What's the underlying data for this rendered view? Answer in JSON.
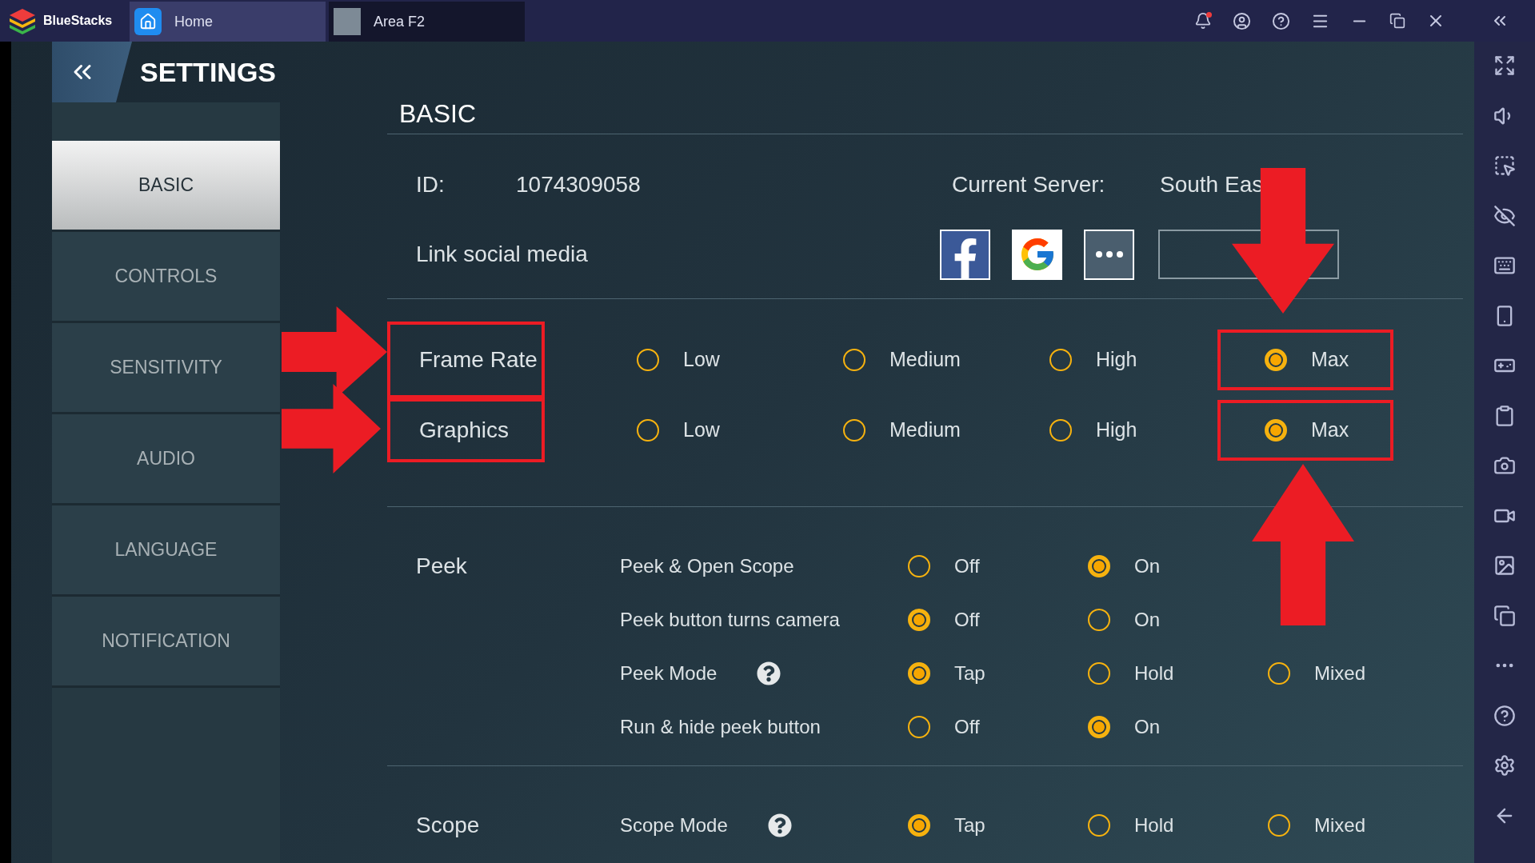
{
  "top_bar": {
    "app_name": "BlueStacks",
    "tabs": [
      {
        "label": "Home",
        "kind": "home",
        "selected": true
      },
      {
        "label": "Area F2",
        "kind": "game",
        "selected": false
      }
    ],
    "notification_dot": true
  },
  "settings": {
    "title": "SETTINGS",
    "menu": [
      {
        "label": "BASIC",
        "selected": true
      },
      {
        "label": "CONTROLS",
        "selected": false
      },
      {
        "label": "SENSITIVITY",
        "selected": false
      },
      {
        "label": "AUDIO",
        "selected": false
      },
      {
        "label": "LANGUAGE",
        "selected": false
      },
      {
        "label": "NOTIFICATION",
        "selected": false
      }
    ]
  },
  "basic": {
    "title": "BASIC",
    "id_label": "ID:",
    "id_value": "1074309058",
    "server_label": "Current Server:",
    "server_value": "South Eas",
    "link_label": "Link social media"
  },
  "quality": [
    {
      "label": "Frame Rate",
      "highlighted": true,
      "options": [
        {
          "label": "Low",
          "selected": false,
          "highlighted": false
        },
        {
          "label": "Medium",
          "selected": false,
          "highlighted": false
        },
        {
          "label": "High",
          "selected": false,
          "highlighted": false
        },
        {
          "label": "Max",
          "selected": true,
          "highlighted": true
        }
      ]
    },
    {
      "label": "Graphics",
      "highlighted": true,
      "options": [
        {
          "label": "Low",
          "selected": false,
          "highlighted": false
        },
        {
          "label": "Medium",
          "selected": false,
          "highlighted": false
        },
        {
          "label": "High",
          "selected": false,
          "highlighted": false
        },
        {
          "label": "Max",
          "selected": true,
          "highlighted": true
        }
      ]
    }
  ],
  "groups": [
    {
      "label": "Peek",
      "rows": [
        {
          "label": "Peek & Open Scope",
          "help": false,
          "options": [
            {
              "label": "Off",
              "selected": false
            },
            {
              "label": "On",
              "selected": true
            }
          ]
        },
        {
          "label": "Peek button turns camera",
          "help": false,
          "options": [
            {
              "label": "Off",
              "selected": true
            },
            {
              "label": "On",
              "selected": false
            }
          ]
        },
        {
          "label": "Peek Mode",
          "help": true,
          "options": [
            {
              "label": "Tap",
              "selected": true
            },
            {
              "label": "Hold",
              "selected": false
            },
            {
              "label": "Mixed",
              "selected": false
            }
          ]
        },
        {
          "label": "Run & hide peek button",
          "help": false,
          "options": [
            {
              "label": "Off",
              "selected": false
            },
            {
              "label": "On",
              "selected": true
            }
          ]
        }
      ]
    },
    {
      "label": "Scope",
      "rows": [
        {
          "label": "Scope Mode",
          "help": true,
          "options": [
            {
              "label": "Tap",
              "selected": true
            },
            {
              "label": "Hold",
              "selected": false
            },
            {
              "label": "Mixed",
              "selected": false
            }
          ]
        }
      ]
    }
  ]
}
